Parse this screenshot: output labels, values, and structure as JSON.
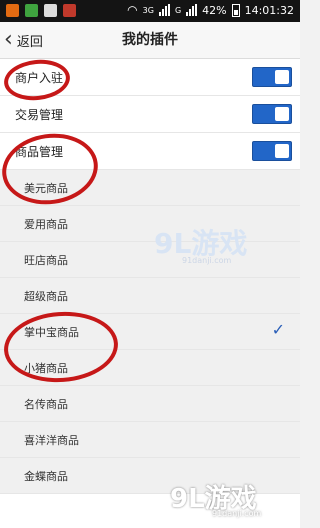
{
  "status_bar": {
    "network": "3G",
    "battery_percent": "42%",
    "time": "14:01:32"
  },
  "nav": {
    "back_label": "返回",
    "title": "我的插件"
  },
  "plugins": [
    {
      "label": "商户入驻",
      "enabled": true
    },
    {
      "label": "交易管理",
      "enabled": true
    },
    {
      "label": "商品管理",
      "enabled": true
    }
  ],
  "sub_items": [
    {
      "label": "美元商品",
      "checked": false
    },
    {
      "label": "爱用商品",
      "checked": false
    },
    {
      "label": "旺店商品",
      "checked": false
    },
    {
      "label": "超级商品",
      "checked": false
    },
    {
      "label": "掌中宝商品",
      "checked": true
    },
    {
      "label": "小猪商品",
      "checked": false
    },
    {
      "label": "名传商品",
      "checked": false
    },
    {
      "label": "喜洋洋商品",
      "checked": false
    },
    {
      "label": "金蝶商品",
      "checked": false
    }
  ],
  "watermark": {
    "brand": "9L游戏",
    "domain": "91danji.com"
  }
}
